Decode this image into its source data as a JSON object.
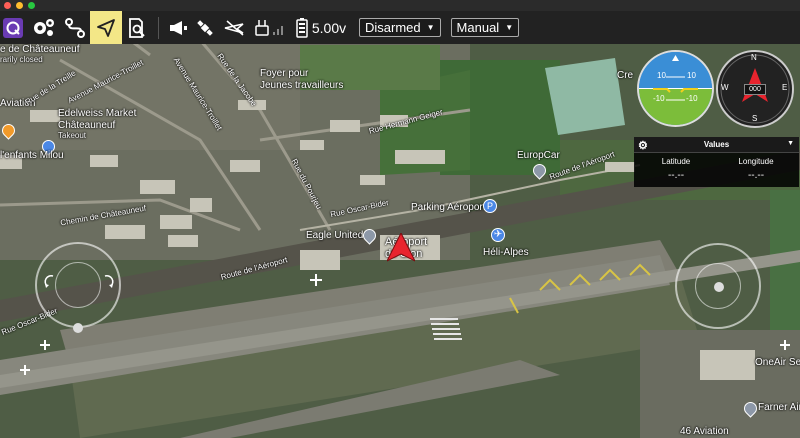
{
  "toolbar": {
    "arming_state": "Disarmed",
    "flight_mode": "Manual",
    "battery_voltage": "5.00v"
  },
  "map_labels": {
    "chateauneuf": "e de Châteauneuf",
    "chateauneuf_status": "rarily closed",
    "foyer_1": "Foyer pour",
    "foyer_2": "Jeunes travailleurs",
    "aviation": "Aviation",
    "edelweiss_1": "Edelweiss Market",
    "edelweiss_2": "Châteauneuf",
    "edelweiss_3": "Takeout",
    "enfants": "l'enfants Milou",
    "europcar": "EuropCar",
    "parking": "Parking Aéroport",
    "eagle": "Eagle United",
    "aeroport_1": "Aéroport",
    "aeroport_2": "de Sion",
    "heli": "Héli-Alpes",
    "oneair": "OneAir Servic",
    "farner": "Farner Air",
    "sixaviation": "46 Aviation",
    "cre": "Cre",
    "rue_treille": "Rue de la Treille",
    "av_maurice": "Avenue Maurice-Troillet",
    "av_maurice2": "Avenue Maurice-Troillet",
    "rue_jacobe": "Rue de la Jacobe",
    "rue_hermann": "Rue Hermann Geiger",
    "rue_aeroport1": "Route de l'Aéroport",
    "rue_aeroport2": "Route de l'Aéroport",
    "rue_pourjeu": "Rue du Pourjeu",
    "rue_oscar": "Rue Oscar-Bider",
    "rue_oscar2": "Rue Oscar-Bider",
    "chemin": "Chemin de Châteauneuf"
  },
  "instruments": {
    "attitude_pitch_up": "10",
    "attitude_pitch_up2": "10",
    "attitude_pitch_down": "-10",
    "attitude_pitch_down2": "-10",
    "compass_n": "N",
    "compass_e": "E",
    "compass_s": "S",
    "compass_w": "W",
    "heading": "000"
  },
  "values_panel": {
    "title": "Values",
    "latitude_label": "Latitude",
    "longitude_label": "Longitude",
    "latitude_value": "--.--",
    "longitude_value": "--.--"
  },
  "colors": {
    "toolbar_bg": "#222222",
    "highlight": "#f3e787",
    "vehicle": "#e8242e"
  }
}
